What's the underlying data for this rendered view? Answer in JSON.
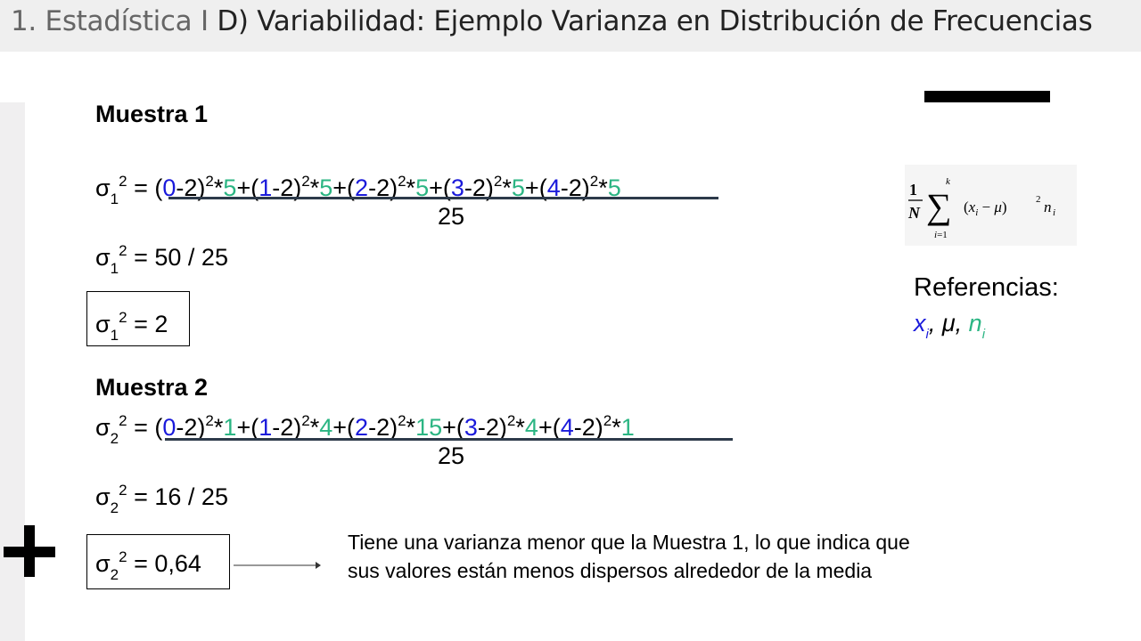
{
  "header": {
    "crumb": "1. Estadística",
    "separator": "I",
    "title": "D) Variabilidad: Ejemplo Varianza en Distribución de Frecuencias"
  },
  "muestra1": {
    "heading": "Muestra 1",
    "line1_prefix": "σ",
    "sub": "1",
    "sup": "2",
    "eq": " = ",
    "terms": [
      {
        "x": "0",
        "n": "5"
      },
      {
        "x": "1",
        "n": "5"
      },
      {
        "x": "2",
        "n": "5"
      },
      {
        "x": "3",
        "n": "5"
      },
      {
        "x": "4",
        "n": "5"
      }
    ],
    "denominator": "25",
    "step2": "50 / 25",
    "result": "2"
  },
  "muestra2": {
    "heading": "Muestra 2",
    "sub": "2",
    "sup": "2",
    "terms": [
      {
        "x": "0",
        "n": "1"
      },
      {
        "x": "1",
        "n": "4"
      },
      {
        "x": "2",
        "n": "15"
      },
      {
        "x": "3",
        "n": "4"
      },
      {
        "x": "4",
        "n": "1"
      }
    ],
    "denominator": "25",
    "step2": "16 / 25",
    "result": "0,64"
  },
  "formula": {
    "text": "1/N Σ_{i=1}^{k} (x_i − μ)^2 n_i"
  },
  "references": {
    "label": "Referencias:",
    "x": "x",
    "x_sub": "i",
    "mu": "μ",
    "n": "n",
    "n_sub": "i"
  },
  "note": "Tiene una varianza menor que la Muestra 1, lo que indica que sus valores están menos dispersos alrededor de la media",
  "colors": {
    "xi": "#1a1adb",
    "ni": "#2bb583",
    "header_bg": "#efefef"
  }
}
